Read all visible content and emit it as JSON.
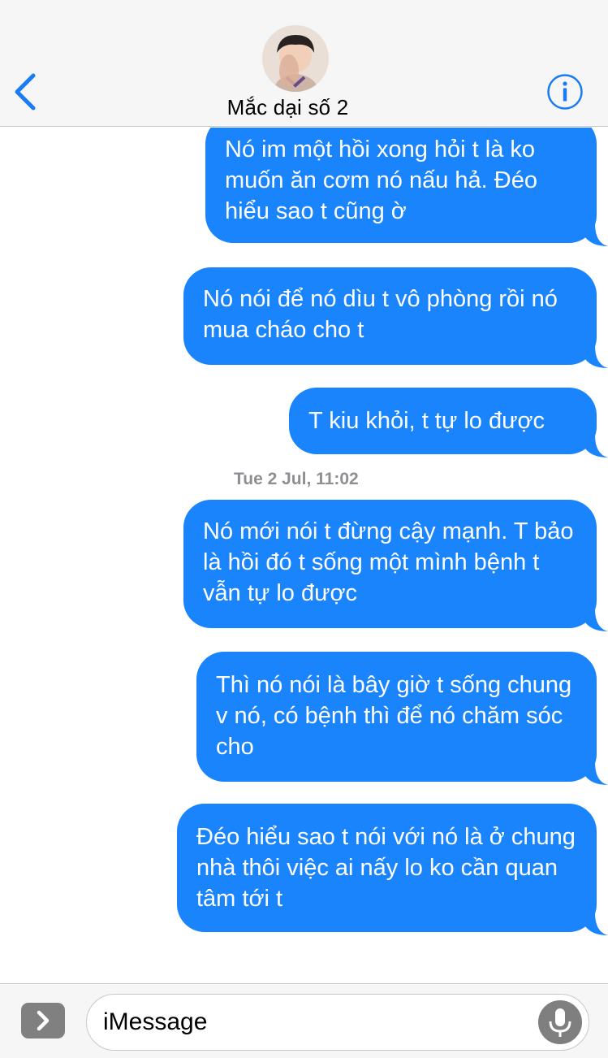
{
  "header": {
    "contact_name": "Mắc dại số 2"
  },
  "messages": [
    {
      "text": "Nó im một hồi xong hỏi t là ko muốn ăn cơm nó nấu hả. Đéo hiểu sao t cũng ờ"
    },
    {
      "text": "Nó nói để nó dìu t vô phòng rồi nó mua cháo cho t"
    },
    {
      "text": "T kiu khỏi, t tự lo được"
    },
    {
      "timestamp": "Tue 2 Jul, 11:02"
    },
    {
      "text": "Nó mới nói t đừng cậy mạnh. T bảo là hồi đó t sống một mình bệnh t vẫn tự lo được"
    },
    {
      "text": "Thì nó nói là bây giờ t sống chung v nó, có bệnh thì để nó chăm sóc cho"
    },
    {
      "text": "Đéo hiểu sao t nói với nó là ở chung nhà thôi việc ai nấy lo ko cần quan tâm tới t"
    }
  ],
  "composer": {
    "placeholder": "iMessage"
  },
  "colors": {
    "bubble": "#1a84fd",
    "accent": "#1a7cf5",
    "header_bg": "#f6f6f6"
  },
  "icons": {
    "back": "chevron-left-icon",
    "info": "info-icon",
    "apps": "chevron-right-icon",
    "mic": "microphone-icon"
  }
}
